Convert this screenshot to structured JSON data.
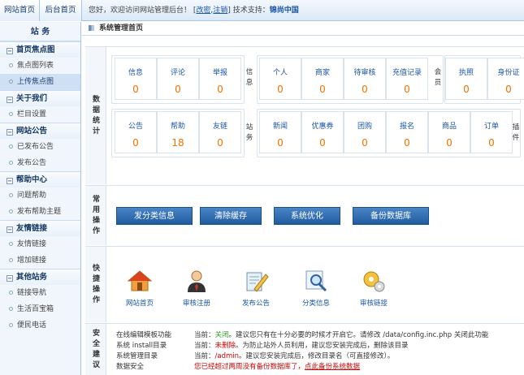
{
  "top": {
    "tab_home": "网站首页",
    "tab_admin": "后台首页",
    "welcome_prefix": "您好，欢迎访问网站管理后台！",
    "link_change": "改密",
    "link_logout": "注销",
    "support_label": "技术支持：",
    "support_brand": "锦尚中国"
  },
  "sidebar": {
    "title": "站 务",
    "groups": [
      {
        "head": "首页焦点图",
        "items": [
          "焦点图列表",
          "上传焦点图"
        ]
      },
      {
        "head": "关于我们",
        "items": [
          "栏目设置"
        ]
      },
      {
        "head": "网站公告",
        "items": [
          "已发布公告",
          "发布公告"
        ]
      },
      {
        "head": "帮助中心",
        "items": [
          "问题帮助",
          "发布帮助主题"
        ]
      },
      {
        "head": "友情链接",
        "items": [
          "友情链接",
          "增加链接"
        ]
      },
      {
        "head": "其他站务",
        "items": [
          "链接导航",
          "生活百宝箱",
          "便民电话"
        ]
      }
    ]
  },
  "main": {
    "crumb": "系统管理首页",
    "sections": {
      "stats": "数据统计",
      "ops": "常用操作",
      "quick": "快捷操作",
      "security": "安全建议"
    },
    "side_labels": {
      "info": "信息",
      "station": "站务",
      "member": "会员",
      "plugin": "插件"
    },
    "stats_row1_left": [
      {
        "label": "信息",
        "value": "0"
      },
      {
        "label": "评论",
        "value": "0"
      },
      {
        "label": "举报",
        "value": "0"
      }
    ],
    "stats_row1_mid": [
      {
        "label": "个人",
        "value": "0"
      },
      {
        "label": "商家",
        "value": "0"
      },
      {
        "label": "待审核",
        "value": "0"
      },
      {
        "label": "充值记录",
        "value": "0"
      }
    ],
    "stats_row1_right": [
      {
        "label": "执照",
        "value": "0"
      },
      {
        "label": "身份证",
        "value": "0"
      }
    ],
    "stats_row2_left": [
      {
        "label": "公告",
        "value": "0"
      },
      {
        "label": "帮助",
        "value": "18"
      },
      {
        "label": "友链",
        "value": "0"
      }
    ],
    "stats_row2_right": [
      {
        "label": "新闻",
        "value": "0"
      },
      {
        "label": "优惠券",
        "value": "0"
      },
      {
        "label": "团购",
        "value": "0"
      },
      {
        "label": "报名",
        "value": "0"
      },
      {
        "label": "商品",
        "value": "0"
      },
      {
        "label": "订单",
        "value": "0"
      }
    ],
    "op_buttons": [
      "发分类信息",
      "清除缓存",
      "系统优化",
      "备份数据库"
    ],
    "quick_items": [
      {
        "label": "网站首页",
        "icon": "house-icon"
      },
      {
        "label": "审核注册",
        "icon": "user-icon"
      },
      {
        "label": "发布公告",
        "icon": "edit-icon"
      },
      {
        "label": "分类信息",
        "icon": "magnifier-icon"
      },
      {
        "label": "审核链接",
        "icon": "gears-icon"
      }
    ],
    "security": [
      {
        "name": "在线编辑模板功能",
        "prefix": "当前：",
        "status": "关闭",
        "status_color": "green",
        "text": "。建议您只有在十分必要的时候才开启它。请修改 /data/config.inc.php 关闭此功能"
      },
      {
        "name": "系统 install目录",
        "prefix": "当前：",
        "status": "未删除",
        "status_color": "red",
        "text": "。为防止站外人员利用，建议您安装完成后，删除该目录"
      },
      {
        "name": "系统管理目录",
        "prefix": "当前：",
        "status": "/admin",
        "status_color": "red",
        "text": "。建议您安装完成后，修改目录名（可直接修改）。"
      },
      {
        "name": "数据安全",
        "prefix": "",
        "status": "您已经超过两周没有备份数据库了，",
        "status_color": "red",
        "text": "",
        "link": "点此备份系统数据"
      }
    ]
  },
  "colors": {
    "accent": "#1a55a8",
    "value": "#f07000",
    "button": "#2a6bb0",
    "ok": "#2e9a1e",
    "warn": "#d10000"
  }
}
